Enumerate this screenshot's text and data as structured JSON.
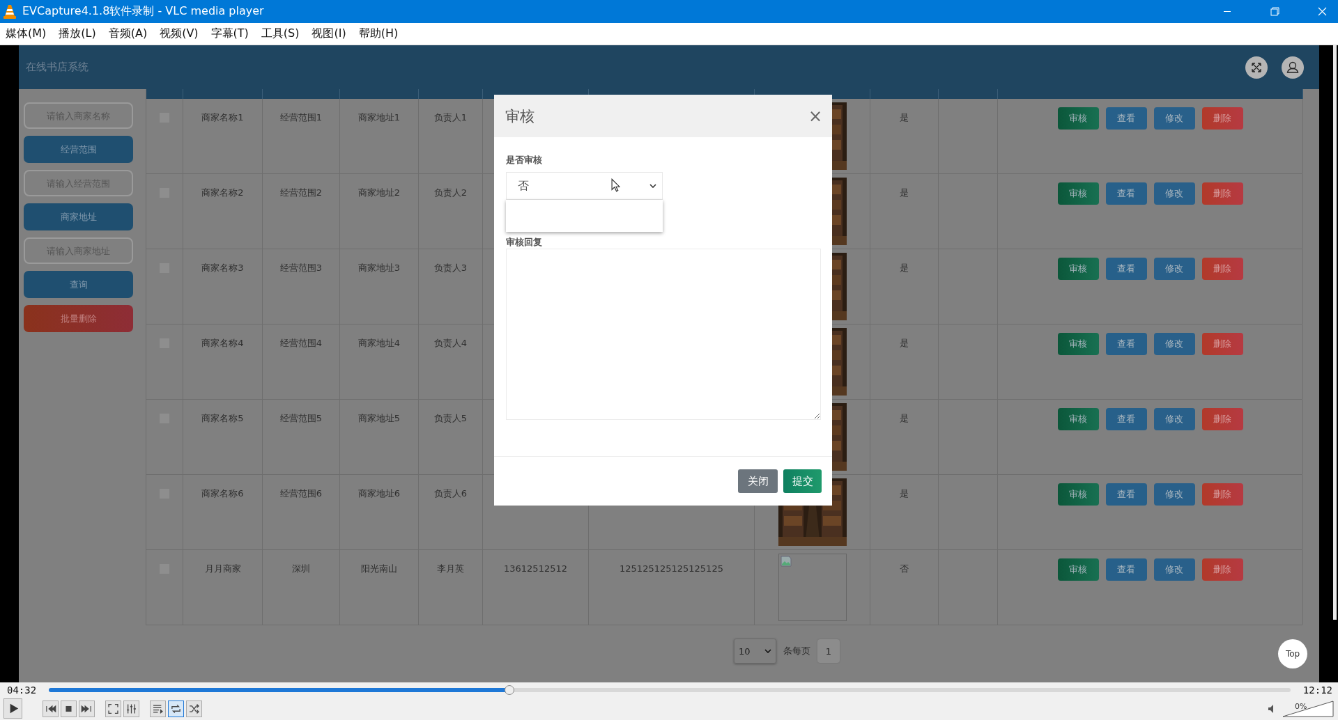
{
  "window": {
    "title": "EVCapture4.1.8软件录制 - VLC media player"
  },
  "menu": [
    {
      "label": "媒体(M)"
    },
    {
      "label": "播放(L)"
    },
    {
      "label": "音频(A)"
    },
    {
      "label": "视频(V)"
    },
    {
      "label": "字幕(T)"
    },
    {
      "label": "工具(S)"
    },
    {
      "label": "视图(I)"
    },
    {
      "label": "帮助(H)"
    }
  ],
  "page": {
    "title": "在线书店系统"
  },
  "sidebar": {
    "items": [
      {
        "kind": "field",
        "placeholder": "请输入商家名称"
      },
      {
        "kind": "button",
        "label": "经营范围"
      },
      {
        "kind": "field",
        "placeholder": "请输入经营范围"
      },
      {
        "kind": "button",
        "label": "商家地址"
      },
      {
        "kind": "field",
        "placeholder": "请输入商家地址"
      },
      {
        "kind": "button",
        "label": "查询"
      },
      {
        "kind": "danger",
        "label": "批量删除"
      }
    ]
  },
  "table": {
    "rows": [
      {
        "checked": false,
        "cells": [
          "商家名称1",
          "经营范围1",
          "商家地址1",
          "负责人1"
        ],
        "audited": "是",
        "actions": [
          {
            "label": "审核",
            "kind": "audit"
          },
          {
            "label": "查看",
            "kind": "view"
          },
          {
            "label": "修改",
            "kind": "edit"
          },
          {
            "label": "删除",
            "kind": "delete"
          }
        ]
      },
      {
        "checked": false,
        "cells": [
          "商家名称2",
          "经营范围2",
          "商家地址2",
          "负责人2"
        ],
        "audited": "是",
        "actions": [
          {
            "label": "审核",
            "kind": "audit"
          },
          {
            "label": "查看",
            "kind": "view"
          },
          {
            "label": "修改",
            "kind": "edit"
          },
          {
            "label": "删除",
            "kind": "delete"
          }
        ]
      },
      {
        "checked": false,
        "cells": [
          "商家名称3",
          "经营范围3",
          "商家地址3",
          "负责人3"
        ],
        "audited": "是",
        "actions": [
          {
            "label": "审核",
            "kind": "audit"
          },
          {
            "label": "查看",
            "kind": "view"
          },
          {
            "label": "修改",
            "kind": "edit"
          },
          {
            "label": "删除",
            "kind": "delete"
          }
        ]
      },
      {
        "checked": false,
        "cells": [
          "商家名称4",
          "经营范围4",
          "商家地址4",
          "负责人4"
        ],
        "audited": "是",
        "actions": [
          {
            "label": "审核",
            "kind": "audit"
          },
          {
            "label": "查看",
            "kind": "view"
          },
          {
            "label": "修改",
            "kind": "edit"
          },
          {
            "label": "删除",
            "kind": "delete"
          }
        ]
      },
      {
        "checked": false,
        "cells": [
          "商家名称5",
          "经营范围5",
          "商家地址5",
          "负责人5"
        ],
        "audited": "是",
        "actions": [
          {
            "label": "审核",
            "kind": "audit"
          },
          {
            "label": "查看",
            "kind": "view"
          },
          {
            "label": "修改",
            "kind": "edit"
          },
          {
            "label": "删除",
            "kind": "delete"
          }
        ]
      },
      {
        "checked": false,
        "cells": [
          "商家名称6",
          "经营范围6",
          "商家地址6",
          "负责人6"
        ],
        "audited": "是",
        "actions": [
          {
            "label": "审核",
            "kind": "audit"
          },
          {
            "label": "查看",
            "kind": "view"
          },
          {
            "label": "修改",
            "kind": "edit"
          },
          {
            "label": "删除",
            "kind": "delete"
          }
        ]
      },
      {
        "checked": false,
        "cells": [
          "月月商家",
          "深圳",
          "阳光南山",
          "李月英",
          "13612512512",
          "125125125125125125"
        ],
        "image": {
          "kind": "broken"
        },
        "audited": "否",
        "actions": [
          {
            "label": "审核",
            "kind": "audit"
          },
          {
            "label": "查看",
            "kind": "view"
          },
          {
            "label": "修改",
            "kind": "edit"
          },
          {
            "label": "删除",
            "kind": "delete"
          }
        ]
      }
    ]
  },
  "pagination": {
    "page_size": "10",
    "per_page_label": "条每页",
    "pages": [
      {
        "label": "1",
        "selected": true
      }
    ]
  },
  "top_button": "Top",
  "modal": {
    "title": "审核",
    "close": "×",
    "fields": [
      {
        "kind": "select",
        "label": "是否审核",
        "value": "否",
        "open": true
      },
      {
        "kind": "textarea",
        "label": "审核回复"
      }
    ],
    "buttons": [
      {
        "label": "关闭",
        "kind": "secondary"
      },
      {
        "label": "提交",
        "kind": "primary"
      }
    ]
  },
  "player": {
    "elapsed": "04:32",
    "total": "12:12",
    "seek": {
      "level": 0.371
    },
    "controls": [
      {
        "kind": "play",
        "on": false
      },
      {
        "kind": "previous",
        "on": false
      },
      {
        "kind": "stop",
        "on": false
      },
      {
        "kind": "next",
        "on": false
      },
      {
        "kind": "fullscreen",
        "on": false
      },
      {
        "kind": "settings",
        "on": false
      },
      {
        "kind": "playlist",
        "on": false
      },
      {
        "kind": "loop",
        "on": true
      },
      {
        "kind": "shuffle",
        "on": false
      }
    ],
    "volume": {
      "label": "0%",
      "level": 0
    }
  }
}
